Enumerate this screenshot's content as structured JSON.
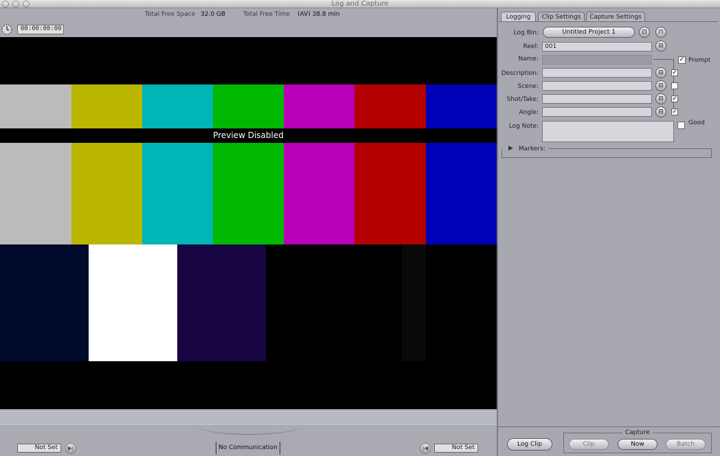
{
  "window": {
    "title": "Log and Capture"
  },
  "status": {
    "free_space_label": "Total Free Space",
    "free_space_value": "32.0 GB",
    "free_time_label": "Total Free Time",
    "free_time_value": "(AV) 38.8 min"
  },
  "timecode": {
    "current": "00:00:00:00"
  },
  "video": {
    "preview_text": "Preview Disabled",
    "top_bars": [
      "#bbbbbb",
      "#bbb700",
      "#00b5b5",
      "#00b800",
      "#b700b8",
      "#b50000",
      "#0000b7"
    ],
    "bottom_bars": [
      "#000a2a",
      "#ffffff",
      "#170543",
      "#000000",
      "#000000",
      "#090909",
      "#000000"
    ]
  },
  "transport": {
    "in_point": "Not Set",
    "out_point": "Not Set",
    "device_status": "No Communication"
  },
  "tabs": [
    {
      "label": "Logging",
      "active": true
    },
    {
      "label": "Clip Settings",
      "active": false
    },
    {
      "label": "Capture Settings",
      "active": false
    }
  ],
  "logging": {
    "log_bin_label": "Log Bin:",
    "log_bin_value": "Untitled Project 1",
    "reel_label": "Reel:",
    "reel_value": "001",
    "name_label": "Name:",
    "name_value": "",
    "prompt_label": "Prompt",
    "prompt_checked": true,
    "description_label": "Description:",
    "description_value": "",
    "description_checked": true,
    "scene_label": "Scene:",
    "scene_value": "",
    "scene_checked": false,
    "shot_take_label": "Shot/Take:",
    "shot_take_value": "",
    "shot_take_checked": true,
    "angle_label": "Angle:",
    "angle_value": "",
    "angle_checked": true,
    "log_note_label": "Log Note:",
    "log_note_value": "",
    "good_label": "Good",
    "good_checked": false,
    "markers_label": "Markers:"
  },
  "capture": {
    "log_clip_label": "Log Clip",
    "group_label": "Capture",
    "clip_label": "Clip",
    "now_label": "Now",
    "batch_label": "Batch"
  },
  "colors": {
    "panel": "#a7a8b0",
    "field": "#d6d7dc",
    "video_bg": "#000000"
  }
}
